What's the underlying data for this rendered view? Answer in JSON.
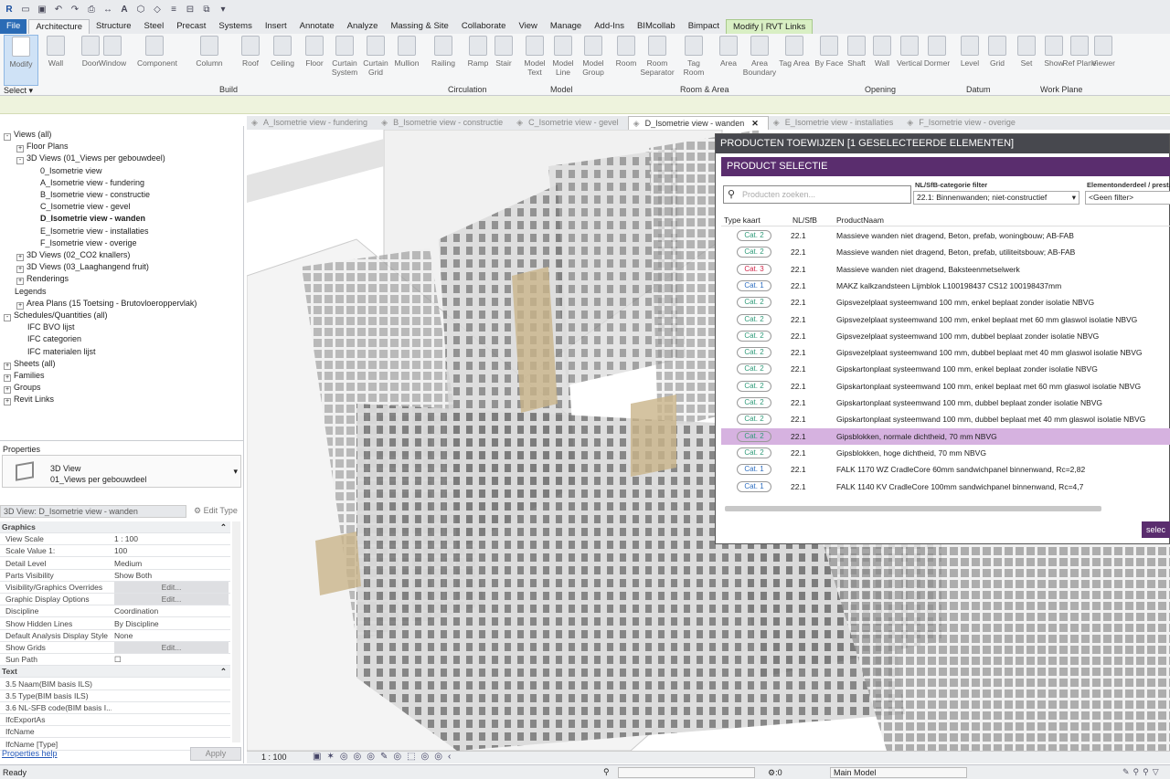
{
  "ribbon": {
    "tabs": [
      "File",
      "Architecture",
      "Structure",
      "Steel",
      "Precast",
      "Systems",
      "Insert",
      "Annotate",
      "Analyze",
      "Massing & Site",
      "Collaborate",
      "View",
      "Manage",
      "Add-Ins",
      "BIMcollab",
      "Bimpact",
      "Modify | RVT Links"
    ],
    "active_tab": "Architecture",
    "tools": [
      {
        "label": "Modify",
        "selected": true
      },
      {
        "label": "Wall"
      },
      {
        "label": "Door"
      },
      {
        "label": "Window"
      },
      {
        "label": "Component"
      },
      {
        "label": "Column"
      },
      {
        "label": "Roof"
      },
      {
        "label": "Ceiling"
      },
      {
        "label": "Floor"
      },
      {
        "label": "Curtain System"
      },
      {
        "label": "Curtain Grid"
      },
      {
        "label": "Mullion"
      },
      {
        "label": "Railing"
      },
      {
        "label": "Ramp"
      },
      {
        "label": "Stair"
      },
      {
        "label": "Model Text"
      },
      {
        "label": "Model Line"
      },
      {
        "label": "Model Group"
      },
      {
        "label": "Room"
      },
      {
        "label": "Room Separator"
      },
      {
        "label": "Tag Room"
      },
      {
        "label": "Area"
      },
      {
        "label": "Area Boundary"
      },
      {
        "label": "Tag Area"
      },
      {
        "label": "By Face"
      },
      {
        "label": "Shaft"
      },
      {
        "label": "Wall"
      },
      {
        "label": "Vertical"
      },
      {
        "label": "Dormer"
      },
      {
        "label": "Level"
      },
      {
        "label": "Grid"
      },
      {
        "label": "Set"
      },
      {
        "label": "Show"
      },
      {
        "label": "Ref Plane"
      },
      {
        "label": "Viewer"
      }
    ],
    "groups": [
      "Build",
      "Circulation",
      "Model",
      "Room & Area",
      "Opening",
      "Datum",
      "Work Plane"
    ],
    "select_label": "Select"
  },
  "browser": {
    "nodes": [
      {
        "text": "Views (all)",
        "level": 0,
        "exp": "-"
      },
      {
        "text": "Floor Plans",
        "level": 1,
        "exp": "+"
      },
      {
        "text": "3D Views (01_Views per gebouwdeel)",
        "level": 1,
        "exp": "-"
      },
      {
        "text": "0_Isometrie view",
        "level": 2
      },
      {
        "text": "A_Isometrie view - fundering",
        "level": 2
      },
      {
        "text": "B_Isometrie view - constructie",
        "level": 2
      },
      {
        "text": "C_Isometrie view - gevel",
        "level": 2
      },
      {
        "text": "D_Isometrie view - wanden",
        "level": 2,
        "bold": true
      },
      {
        "text": "E_Isometrie view - installaties",
        "level": 2
      },
      {
        "text": "F_Isometrie view - overige",
        "level": 2
      },
      {
        "text": "3D Views (02_CO2 knallers)",
        "level": 1,
        "exp": "+"
      },
      {
        "text": "3D Views (03_Laaghangend fruit)",
        "level": 1,
        "exp": "+"
      },
      {
        "text": "Renderings",
        "level": 1,
        "exp": "+"
      },
      {
        "text": "Legends",
        "level": 0
      },
      {
        "text": "Area Plans (15 Toetsing - Brutovloeroppervlak)",
        "level": 1,
        "exp": "+"
      },
      {
        "text": "Schedules/Quantities (all)",
        "level": 0,
        "exp": "-"
      },
      {
        "text": "IFC BVO lijst",
        "level": 1
      },
      {
        "text": "IFC categorien",
        "level": 1
      },
      {
        "text": "IFC materialen lijst",
        "level": 1
      },
      {
        "text": "Sheets (all)",
        "level": 0,
        "exp": "+"
      },
      {
        "text": "Families",
        "level": 0,
        "exp": "+"
      },
      {
        "text": "Groups",
        "level": 0,
        "exp": "+"
      },
      {
        "text": "Revit Links",
        "level": 0,
        "exp": "+"
      }
    ]
  },
  "properties": {
    "title": "Properties",
    "type_line1": "3D View",
    "type_line2": "01_Views per gebouwdeel",
    "instance": "3D View: D_Isometrie view - wanden",
    "edit_type": "Edit Type",
    "rows": [
      {
        "k": "Graphics",
        "sec": true
      },
      {
        "k": "View Scale",
        "v": "1 : 100"
      },
      {
        "k": "Scale Value    1:",
        "v": "100"
      },
      {
        "k": "Detail Level",
        "v": "Medium"
      },
      {
        "k": "Parts Visibility",
        "v": "Show Both"
      },
      {
        "k": "Visibility/Graphics Overrides",
        "v": "Edit...",
        "btn": true
      },
      {
        "k": "Graphic Display Options",
        "v": "Edit...",
        "btn": true
      },
      {
        "k": "Discipline",
        "v": "Coordination"
      },
      {
        "k": "Show Hidden Lines",
        "v": "By Discipline"
      },
      {
        "k": "Default Analysis Display Style",
        "v": "None"
      },
      {
        "k": "Show Grids",
        "v": "Edit...",
        "btn": true
      },
      {
        "k": "Sun Path",
        "v": "☐"
      },
      {
        "k": "Text",
        "sec": true
      },
      {
        "k": "3.5 Naam(BIM basis ILS)",
        "v": ""
      },
      {
        "k": "3.5 Type(BIM basis ILS)",
        "v": ""
      },
      {
        "k": "3.6 NL-SFB code(BIM basis I...",
        "v": ""
      },
      {
        "k": "IfcExportAs",
        "v": ""
      },
      {
        "k": "IfcName",
        "v": ""
      },
      {
        "k": "IfcName [Type]",
        "v": ""
      }
    ],
    "help": "Properties help",
    "apply": "Apply"
  },
  "view_tabs": [
    {
      "label": "A_Isometrie view - fundering"
    },
    {
      "label": "B_Isometrie view - constructie"
    },
    {
      "label": "C_Isometrie view - gevel"
    },
    {
      "label": "D_Isometrie view - wanden",
      "active": true
    },
    {
      "label": "E_Isometrie view - installaties"
    },
    {
      "label": "F_Isometrie view - overige"
    }
  ],
  "view_bar": {
    "scale": "1 : 100"
  },
  "dialog": {
    "title": "PRODUCTEN TOEWIJZEN [1 GESELECTEERDE ELEMENTEN]",
    "subtitle": "PRODUCT SELECTIE",
    "search_placeholder": "Producten zoeken...",
    "filter1_label": "NL/SfB-categorie filter",
    "filter1_value": "22.1: Binnenwanden; niet-constructief",
    "filter2_label": "Elementonderdeel / prestat",
    "filter2_value": "<Geen filter>",
    "columns": [
      "Type kaart",
      "NL/SfB",
      "ProductNaam"
    ],
    "rows": [
      {
        "cat": "Cat. 2",
        "nl": "22.1",
        "name": "Massieve wanden niet dragend, Beton, prefab, woningbouw; AB-FAB"
      },
      {
        "cat": "Cat. 2",
        "nl": "22.1",
        "name": "Massieve wanden niet dragend, Beton, prefab, utiliteitsbouw; AB-FAB"
      },
      {
        "cat": "Cat. 3",
        "nl": "22.1",
        "name": "Massieve wanden niet dragend, Baksteenmetselwerk"
      },
      {
        "cat": "Cat. 1",
        "nl": "22.1",
        "name": "MAKZ kalkzandsteen Lijmblok L100198437 CS12 100198437mm"
      },
      {
        "cat": "Cat. 2",
        "nl": "22.1",
        "name": "Gipsvezelplaat systeemwand 100 mm, enkel beplaat zonder isolatie NBVG"
      },
      {
        "cat": "Cat. 2",
        "nl": "22.1",
        "name": "Gipsvezelplaat systeemwand 100 mm, enkel beplaat met 60 mm glaswol isolatie NBVG"
      },
      {
        "cat": "Cat. 2",
        "nl": "22.1",
        "name": "Gipsvezelplaat systeemwand 100 mm, dubbel beplaat zonder isolatie NBVG"
      },
      {
        "cat": "Cat. 2",
        "nl": "22.1",
        "name": "Gipsvezelplaat systeemwand 100 mm, dubbel beplaat met 40 mm glaswol isolatie NBVG"
      },
      {
        "cat": "Cat. 2",
        "nl": "22.1",
        "name": "Gipskartonplaat systeemwand 100 mm, enkel beplaat zonder isolatie NBVG"
      },
      {
        "cat": "Cat. 2",
        "nl": "22.1",
        "name": "Gipskartonplaat systeemwand 100 mm, enkel beplaat met 60 mm glaswol isolatie NBVG"
      },
      {
        "cat": "Cat. 2",
        "nl": "22.1",
        "name": "Gipskartonplaat systeemwand 100 mm, dubbel beplaat zonder isolatie NBVG"
      },
      {
        "cat": "Cat. 2",
        "nl": "22.1",
        "name": "Gipskartonplaat systeemwand 100 mm, dubbel beplaat met 40 mm glaswol isolatie NBVG"
      },
      {
        "cat": "Cat. 2",
        "nl": "22.1",
        "name": "Gipsblokken, normale dichtheid, 70 mm NBVG",
        "selected": true
      },
      {
        "cat": "Cat. 2",
        "nl": "22.1",
        "name": "Gipsblokken, hoge dichtheid, 70 mm NBVG"
      },
      {
        "cat": "Cat. 1",
        "nl": "22.1",
        "name": "FALK 1170 WZ CradleCore 60mm sandwichpanel binnenwand, Rc=2,82"
      },
      {
        "cat": "Cat. 1",
        "nl": "22.1",
        "name": "FALK 1140 KV CradleCore 100mm sandwichpanel binnenwand, Rc=4,7"
      }
    ],
    "select_button": "selec"
  },
  "status": {
    "ready": "Ready",
    "zero": ":0",
    "model": "Main Model"
  },
  "colors": {
    "accent": "#5a2d6e",
    "selected_row": "#d6b2e0",
    "file_tab": "#2a6bb5"
  }
}
